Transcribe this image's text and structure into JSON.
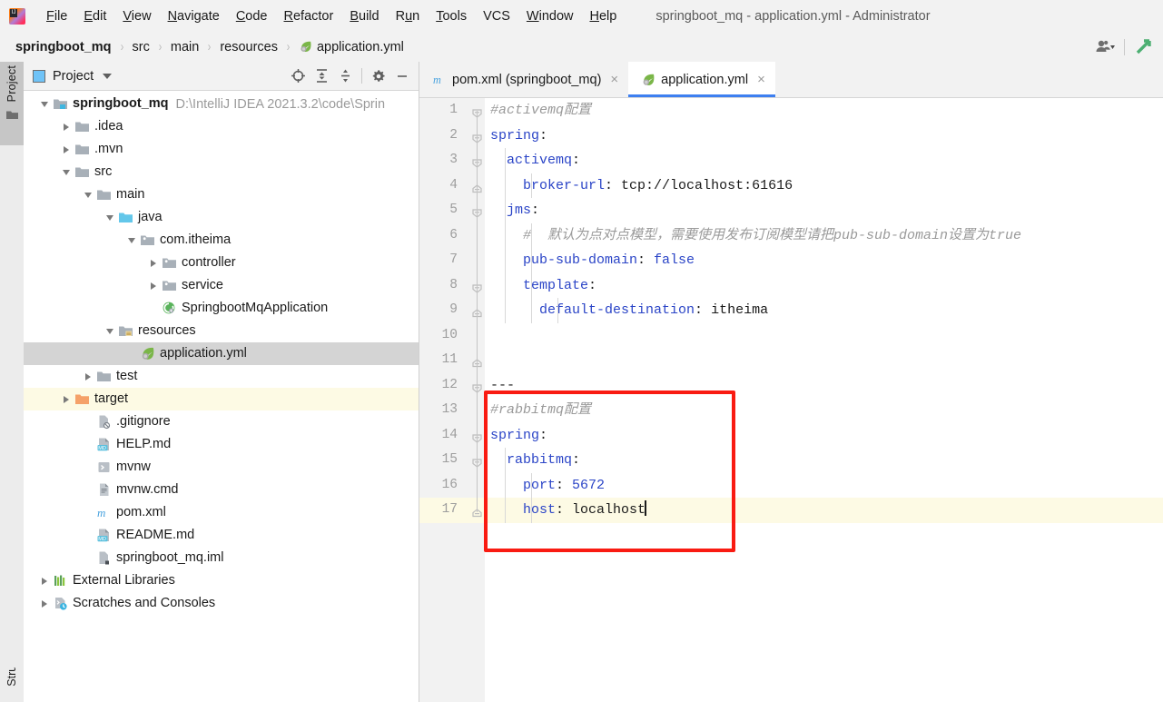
{
  "window": {
    "title": "springboot_mq - application.yml - Administrator",
    "app_icon": "intellij-idea-logo"
  },
  "menu": {
    "items": [
      {
        "label": "File",
        "mnemonic": "F"
      },
      {
        "label": "Edit",
        "mnemonic": "E"
      },
      {
        "label": "View",
        "mnemonic": "V"
      },
      {
        "label": "Navigate",
        "mnemonic": "N"
      },
      {
        "label": "Code",
        "mnemonic": "C"
      },
      {
        "label": "Refactor",
        "mnemonic": "R"
      },
      {
        "label": "Build",
        "mnemonic": "B"
      },
      {
        "label": "Run",
        "mnemonic": "u"
      },
      {
        "label": "Tools",
        "mnemonic": "T"
      },
      {
        "label": "VCS",
        "mnemonic": ""
      },
      {
        "label": "Window",
        "mnemonic": "W"
      },
      {
        "label": "Help",
        "mnemonic": "H"
      }
    ]
  },
  "breadcrumb": {
    "separator": "›",
    "items": [
      {
        "label": "springboot_mq",
        "bold": true,
        "icon": ""
      },
      {
        "label": "src",
        "bold": false,
        "icon": ""
      },
      {
        "label": "main",
        "bold": false,
        "icon": ""
      },
      {
        "label": "resources",
        "bold": false,
        "icon": ""
      },
      {
        "label": "application.yml",
        "bold": false,
        "icon": "yaml-leaf-icon"
      }
    ],
    "right_icons": [
      "user-avatar-icon",
      "chevron-down-icon",
      "search-everywhere-icon"
    ]
  },
  "tool_strip": {
    "project_tab": "Project",
    "bottom_tab": "Structure"
  },
  "project_panel": {
    "title": "Project",
    "toolbar_icons": [
      "locate-icon",
      "expand-all-icon",
      "collapse-all-icon",
      "settings-gear-icon",
      "hide-icon"
    ],
    "tree": [
      {
        "label": "springboot_mq",
        "path": "D:\\IntelliJ IDEA 2021.3.2\\code\\Sprin",
        "depth": 0,
        "twisty": "open",
        "icon": "module-folder-icon",
        "bold": true,
        "state": "normal"
      },
      {
        "label": ".idea",
        "path": "",
        "depth": 1,
        "twisty": "closed",
        "icon": "folder-icon",
        "bold": false,
        "state": "normal"
      },
      {
        "label": ".mvn",
        "path": "",
        "depth": 1,
        "twisty": "closed",
        "icon": "folder-icon",
        "bold": false,
        "state": "normal"
      },
      {
        "label": "src",
        "path": "",
        "depth": 1,
        "twisty": "open",
        "icon": "folder-icon",
        "bold": false,
        "state": "normal"
      },
      {
        "label": "main",
        "path": "",
        "depth": 2,
        "twisty": "open",
        "icon": "folder-icon",
        "bold": false,
        "state": "normal"
      },
      {
        "label": "java",
        "path": "",
        "depth": 3,
        "twisty": "open",
        "icon": "source-root-icon",
        "bold": false,
        "state": "normal"
      },
      {
        "label": "com.itheima",
        "path": "",
        "depth": 4,
        "twisty": "open",
        "icon": "package-icon",
        "bold": false,
        "state": "normal"
      },
      {
        "label": "controller",
        "path": "",
        "depth": 5,
        "twisty": "closed",
        "icon": "package-icon",
        "bold": false,
        "state": "normal"
      },
      {
        "label": "service",
        "path": "",
        "depth": 5,
        "twisty": "closed",
        "icon": "package-icon",
        "bold": false,
        "state": "normal"
      },
      {
        "label": "SpringbootMqApplication",
        "path": "",
        "depth": 5,
        "twisty": "none",
        "icon": "spring-boot-class-icon",
        "bold": false,
        "state": "normal"
      },
      {
        "label": "resources",
        "path": "",
        "depth": 3,
        "twisty": "open",
        "icon": "resource-root-icon",
        "bold": false,
        "state": "normal"
      },
      {
        "label": "application.yml",
        "path": "",
        "depth": 4,
        "twisty": "none",
        "icon": "yaml-leaf-icon",
        "bold": false,
        "state": "selected"
      },
      {
        "label": "test",
        "path": "",
        "depth": 2,
        "twisty": "closed",
        "icon": "folder-icon",
        "bold": false,
        "state": "normal"
      },
      {
        "label": "target",
        "path": "",
        "depth": 1,
        "twisty": "closed",
        "icon": "excluded-folder-icon",
        "bold": false,
        "state": "highlight"
      },
      {
        "label": ".gitignore",
        "path": "",
        "depth": 2,
        "twisty": "none",
        "icon": "gitignore-file-icon",
        "bold": false,
        "state": "normal"
      },
      {
        "label": "HELP.md",
        "path": "",
        "depth": 2,
        "twisty": "none",
        "icon": "markdown-file-icon",
        "bold": false,
        "state": "normal"
      },
      {
        "label": "mvnw",
        "path": "",
        "depth": 2,
        "twisty": "none",
        "icon": "shell-script-icon",
        "bold": false,
        "state": "normal"
      },
      {
        "label": "mvnw.cmd",
        "path": "",
        "depth": 2,
        "twisty": "none",
        "icon": "text-file-icon",
        "bold": false,
        "state": "normal"
      },
      {
        "label": "pom.xml",
        "path": "",
        "depth": 2,
        "twisty": "none",
        "icon": "maven-file-icon",
        "bold": false,
        "state": "normal"
      },
      {
        "label": "README.md",
        "path": "",
        "depth": 2,
        "twisty": "none",
        "icon": "markdown-file-icon",
        "bold": false,
        "state": "normal"
      },
      {
        "label": "springboot_mq.iml",
        "path": "",
        "depth": 2,
        "twisty": "none",
        "icon": "iml-file-icon",
        "bold": false,
        "state": "normal"
      },
      {
        "label": "External Libraries",
        "path": "",
        "depth": 0,
        "twisty": "closed",
        "icon": "libraries-icon",
        "bold": false,
        "state": "normal"
      },
      {
        "label": "Scratches and Consoles",
        "path": "",
        "depth": 0,
        "twisty": "closed",
        "icon": "scratches-icon",
        "bold": false,
        "state": "normal"
      }
    ]
  },
  "editor": {
    "tabs": [
      {
        "label": "pom.xml (springboot_mq)",
        "icon": "maven-file-icon",
        "active": false,
        "close": "×"
      },
      {
        "label": "application.yml",
        "icon": "yaml-leaf-icon",
        "active": true,
        "close": "×"
      }
    ],
    "current_line": 17,
    "caret_line": 17,
    "annotation_box_color": "#f91b12",
    "lines": [
      {
        "n": 1,
        "fold": "start",
        "hl": false,
        "tokens": [
          {
            "t": "#activemq配置",
            "c": "cmt"
          }
        ]
      },
      {
        "n": 2,
        "fold": "start",
        "hl": false,
        "tokens": [
          {
            "t": "spring",
            "c": "key"
          },
          {
            "t": ":",
            "c": "val"
          }
        ]
      },
      {
        "n": 3,
        "fold": "start",
        "hl": false,
        "tokens": [
          {
            "t": "  activemq",
            "c": "key"
          },
          {
            "t": ":",
            "c": "val"
          }
        ]
      },
      {
        "n": 4,
        "fold": "end",
        "hl": false,
        "tokens": [
          {
            "t": "    broker-url",
            "c": "key"
          },
          {
            "t": ": ",
            "c": "val"
          },
          {
            "t": "tcp://localhost:61616",
            "c": "val"
          }
        ]
      },
      {
        "n": 5,
        "fold": "start",
        "hl": false,
        "tokens": [
          {
            "t": "  jms",
            "c": "key"
          },
          {
            "t": ":",
            "c": "val"
          }
        ]
      },
      {
        "n": 6,
        "fold": "none",
        "hl": false,
        "tokens": [
          {
            "t": "    #  默认为点对点模型，需要使用发布订阅模型请把pub-sub-domain设置为true",
            "c": "cmt"
          }
        ]
      },
      {
        "n": 7,
        "fold": "none",
        "hl": false,
        "tokens": [
          {
            "t": "    pub-sub-domain",
            "c": "key"
          },
          {
            "t": ": ",
            "c": "val"
          },
          {
            "t": "false",
            "c": "bool"
          }
        ]
      },
      {
        "n": 8,
        "fold": "start",
        "hl": false,
        "tokens": [
          {
            "t": "    template",
            "c": "key"
          },
          {
            "t": ":",
            "c": "val"
          }
        ]
      },
      {
        "n": 9,
        "fold": "end",
        "hl": false,
        "tokens": [
          {
            "t": "      default-destination",
            "c": "key"
          },
          {
            "t": ": ",
            "c": "val"
          },
          {
            "t": "itheima",
            "c": "val"
          }
        ]
      },
      {
        "n": 10,
        "fold": "none",
        "hl": false,
        "tokens": []
      },
      {
        "n": 11,
        "fold": "end",
        "hl": false,
        "tokens": []
      },
      {
        "n": 12,
        "fold": "start",
        "hl": false,
        "tokens": [
          {
            "t": "---",
            "c": "dash"
          }
        ]
      },
      {
        "n": 13,
        "fold": "none",
        "hl": false,
        "tokens": [
          {
            "t": "#rabbitmq配置",
            "c": "cmt"
          }
        ]
      },
      {
        "n": 14,
        "fold": "start",
        "hl": false,
        "tokens": [
          {
            "t": "spring",
            "c": "key"
          },
          {
            "t": ":",
            "c": "val"
          }
        ]
      },
      {
        "n": 15,
        "fold": "start",
        "hl": false,
        "tokens": [
          {
            "t": "  rabbitmq",
            "c": "key"
          },
          {
            "t": ":",
            "c": "val"
          }
        ]
      },
      {
        "n": 16,
        "fold": "none",
        "hl": false,
        "tokens": [
          {
            "t": "    port",
            "c": "key"
          },
          {
            "t": ": ",
            "c": "val"
          },
          {
            "t": "5672",
            "c": "num"
          }
        ]
      },
      {
        "n": 17,
        "fold": "end",
        "hl": true,
        "tokens": [
          {
            "t": "    host",
            "c": "key"
          },
          {
            "t": ": ",
            "c": "val"
          },
          {
            "t": "localhost",
            "c": "val"
          }
        ],
        "caret": true
      }
    ]
  },
  "colors": {
    "accent_blue": "#3d7ff0",
    "keyword_blue": "#2b45c7",
    "comment_gray": "#9a9a9a",
    "annotation_red": "#f91b12",
    "current_line": "#fdfae4",
    "selection_gray": "#d4d4d4"
  }
}
